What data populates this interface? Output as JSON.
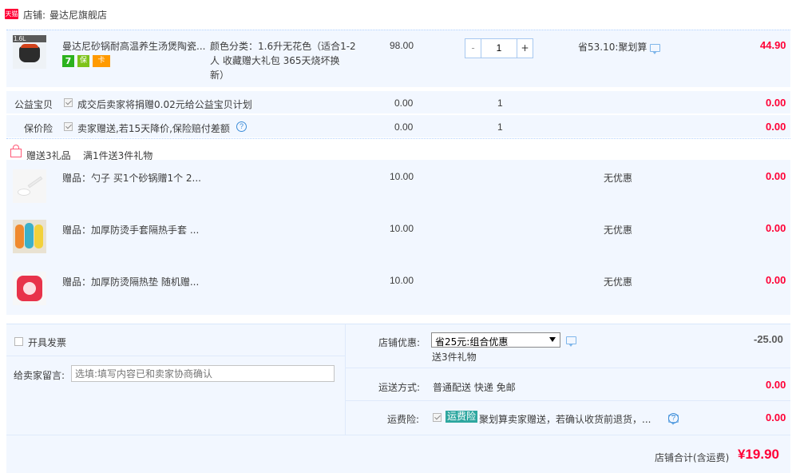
{
  "shop": {
    "icon_text": "天猫",
    "label": "店铺:",
    "name": "曼达尼旗舰店"
  },
  "main_item": {
    "thumb_badge": "1.6L",
    "title": "曼达尼砂锅耐高温养生汤煲陶瓷...",
    "sku_line1": "颜色分类：1.6升无花色（适合1-2",
    "sku_line2": "人 收藏赠大礼包 365天烧坏换",
    "sku_line3": "新）",
    "badges": [
      "7",
      "保",
      "卡"
    ],
    "price": "98.00",
    "qty_minus": "-",
    "qty": "1",
    "qty_plus": "+",
    "discount": "省53.10:聚划算",
    "subtotal": "44.90"
  },
  "extras": [
    {
      "name": "公益宝贝",
      "desc": "成交后卖家将捐赠0.02元给公益宝贝计划",
      "price": "0.00",
      "qty": "1",
      "total": "0.00"
    },
    {
      "name": "保价险",
      "desc": "卖家赠送,若15天降价,保险赔付差额",
      "price": "0.00",
      "qty": "1",
      "total": "0.00"
    }
  ],
  "gift_header": {
    "label": "赠送3礼品",
    "rule": "满1件送3件礼物"
  },
  "gifts": [
    {
      "title": "赠品：勺子 买1个砂锅赠1个 2...",
      "price": "10.00",
      "discount": "无优惠",
      "total": "0.00"
    },
    {
      "title": "赠品：加厚防烫手套隔热手套 ...",
      "price": "10.00",
      "discount": "无优惠",
      "total": "0.00"
    },
    {
      "title": "赠品：加厚防烫隔热垫 随机赠...",
      "price": "10.00",
      "discount": "无优惠",
      "total": "0.00"
    }
  ],
  "invoice": {
    "label": "开具发票"
  },
  "message": {
    "label": "给卖家留言:",
    "placeholder": "选填:填写内容已和卖家协商确认"
  },
  "shop_discount": {
    "label": "店铺优惠:",
    "selected": "省25元:组合优惠",
    "note": "送3件礼物",
    "amount": "-25.00"
  },
  "shipping": {
    "label": "运送方式:",
    "value": "普通配送 快递 免邮",
    "amount": "0.00"
  },
  "freight_insurance": {
    "label": "运费险:",
    "tag": "运费险",
    "desc": "聚划算卖家赠送，若确认收货前退货，...",
    "amount": "0.00"
  },
  "total": {
    "label": "店铺合计(含运费)",
    "value": "¥19.90"
  },
  "colors": {
    "accent_red": "#ff0036",
    "panel_blue": "#f2f7ff",
    "link_blue": "#3d8dd8",
    "insurance_green": "#2ea7a0"
  }
}
